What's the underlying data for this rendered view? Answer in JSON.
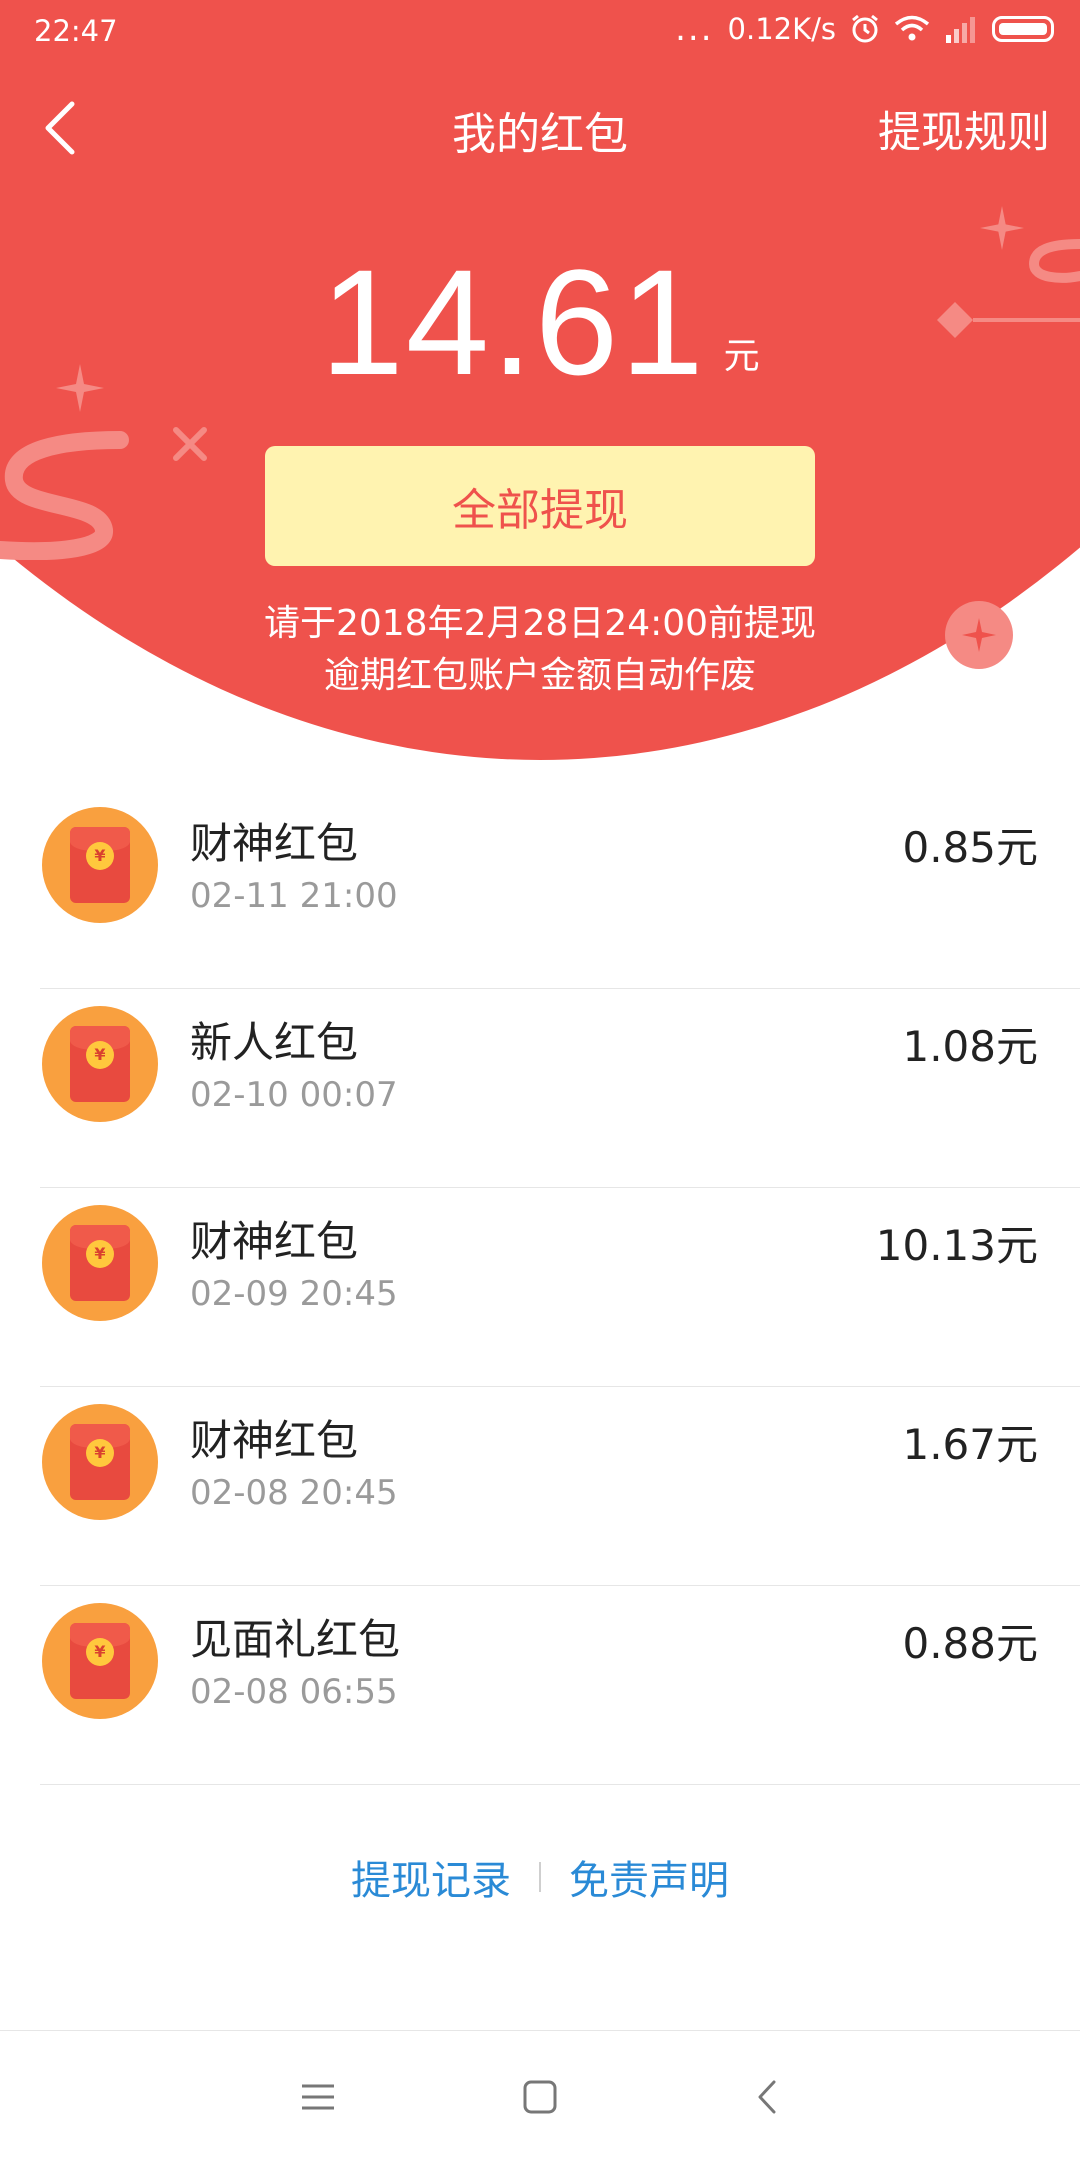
{
  "status_bar": {
    "time": "22:47",
    "dots": "...",
    "network_speed": "0.12K/s"
  },
  "header": {
    "title": "我的红包",
    "rules_link": "提现规则",
    "balance": "14.61",
    "balance_unit": "元",
    "withdraw_all_button": "全部提现",
    "notice_line1": "请于2018年2月28日24:00前提现",
    "notice_line2": "逾期红包账户金额自动作废"
  },
  "colors": {
    "header_red": "#ef524c",
    "button_yellow": "#fff3b0",
    "link_blue": "#2a8ad6",
    "icon_orange": "#f9a03f"
  },
  "items": [
    {
      "title": "财神红包",
      "time": "02-11 21:00",
      "amount": "0.85元",
      "icon": "red-envelope-icon"
    },
    {
      "title": "新人红包",
      "time": "02-10 00:07",
      "amount": "1.08元",
      "icon": "red-envelope-icon"
    },
    {
      "title": "财神红包",
      "time": "02-09 20:45",
      "amount": "10.13元",
      "icon": "red-envelope-icon"
    },
    {
      "title": "财神红包",
      "time": "02-08 20:45",
      "amount": "1.67元",
      "icon": "red-envelope-icon"
    },
    {
      "title": "见面礼红包",
      "time": "02-08 06:55",
      "amount": "0.88元",
      "icon": "red-envelope-icon"
    }
  ],
  "footer": {
    "withdraw_history": "提现记录",
    "disclaimer": "免责声明"
  },
  "icons": {
    "coin_symbol": "¥"
  }
}
